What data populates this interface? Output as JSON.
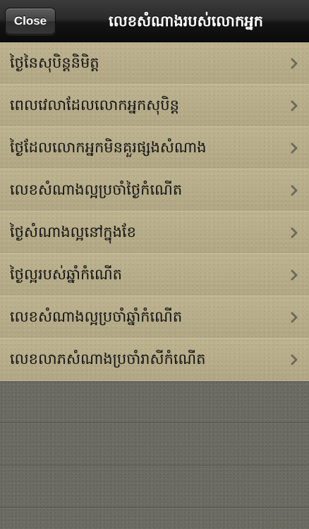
{
  "navbar": {
    "close_label": "Close",
    "title": "លេខសំណាងរបស់លោកអ្នក"
  },
  "menu": {
    "items": [
      {
        "label": "ថ្ងៃនៃសុបិន្តនិមិត្ត"
      },
      {
        "label": "ពេលវេលាដែលលោកអ្នកសុបិន្ត"
      },
      {
        "label": "ថ្ងៃដែលលោកអ្នកមិនគួរផ្សងសំណាង"
      },
      {
        "label": "លេខសំណាងល្អប្រចាំថ្ងៃកំណើត"
      },
      {
        "label": "ថ្ងៃសំណាងល្អនៅក្នុងខែ"
      },
      {
        "label": "ថ្ងៃល្អរបស់ឆ្នាំកំណើត"
      },
      {
        "label": "លេខសំណាងល្អប្រចាំឆ្នាំកំណើត"
      },
      {
        "label": "លេខលាភសំណាងប្រចាំរាសីកំណើត"
      }
    ],
    "chevron_icon": "chevron-right-icon"
  },
  "colors": {
    "navbar": "#1a1a1a",
    "row_background": "#b8ae8a",
    "empty_background": "#6c6c63",
    "chevron": "#6e6a5a"
  }
}
